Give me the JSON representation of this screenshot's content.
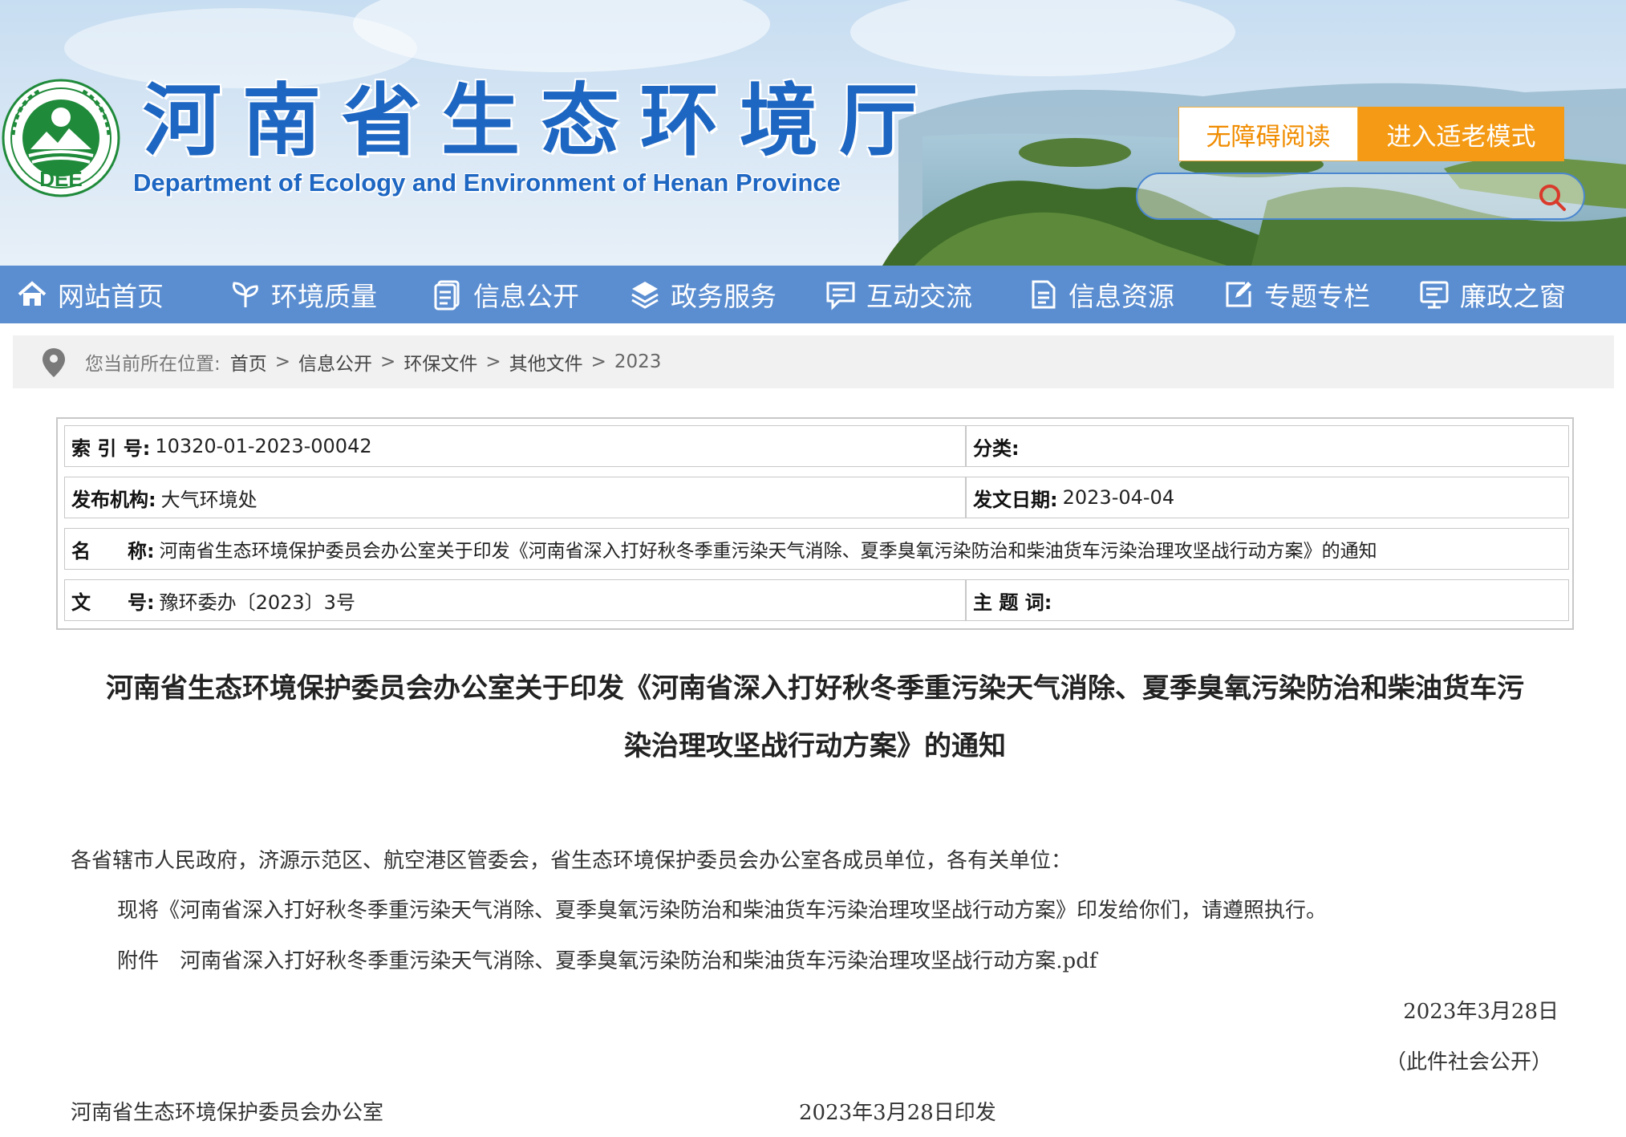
{
  "header": {
    "site_title": "河南省生态环境厅",
    "site_subtitle": "Department of Ecology and Environment of Henan Province",
    "logo_text": "DEE",
    "accessible_btn": "无障碍阅读",
    "elder_btn": "进入适老模式",
    "search_placeholder": ""
  },
  "nav": {
    "items": [
      {
        "label": "网站首页",
        "icon": "home-icon"
      },
      {
        "label": "环境质量",
        "icon": "sprout-icon"
      },
      {
        "label": "信息公开",
        "icon": "document-stack-icon"
      },
      {
        "label": "政务服务",
        "icon": "layers-icon"
      },
      {
        "label": "互动交流",
        "icon": "chat-icon"
      },
      {
        "label": "信息资源",
        "icon": "file-icon"
      },
      {
        "label": "专题专栏",
        "icon": "edit-icon"
      },
      {
        "label": "廉政之窗",
        "icon": "monitor-icon"
      }
    ]
  },
  "breadcrumb": {
    "lead": "您当前所在位置:",
    "items": [
      "首页",
      "信息公开",
      "环保文件",
      "其他文件"
    ],
    "current": "2023",
    "separator": ">"
  },
  "meta": {
    "index_label": "索 引 号:",
    "index_value": "10320-01-2023-00042",
    "category_label": "分类:",
    "category_value": "",
    "publisher_label": "发布机构:",
    "publisher_value": "大气环境处",
    "date_label": "发文日期:",
    "date_value": "2023-04-04",
    "name_label_1": "名",
    "name_label_2": "称:",
    "name_value": "河南省生态环境保护委员会办公室关于印发《河南省深入打好秋冬季重污染天气消除、夏季臭氧污染防治和柴油货车污染治理攻坚战行动方案》的通知",
    "docno_label_1": "文",
    "docno_label_2": "号:",
    "docno_value": "豫环委办〔2023〕3号",
    "subject_label": "主 题 词:",
    "subject_value": ""
  },
  "article": {
    "title_line1": "河南省生态环境保护委员会办公室关于印发《河南省深入打好秋冬季重污染天气消除、夏季臭氧污染防治和柴油货车污",
    "title_line2": "染治理攻坚战行动方案》的通知",
    "salutation": "各省辖市人民政府，济源示范区、航空港区管委会，省生态环境保护委员会办公室各成员单位，各有关单位：",
    "para1": "现将《河南省深入打好秋冬季重污染天气消除、夏季臭氧污染防治和柴油货车污染治理攻坚战行动方案》印发给你们，请遵照执行。",
    "attachment_label": "附件",
    "attachment_link": "河南省深入打好秋冬季重污染天气消除、夏季臭氧污染防治和柴油货车污染治理攻坚战行动方案.pdf",
    "sign_date": "2023年3月28日",
    "public_note": "（此件社会公开）",
    "footer_org": "河南省生态环境保护委员会办公室",
    "footer_print": "2023年3月28日印发"
  },
  "colors": {
    "title_blue": "#1d66c2",
    "nav_bg": "#5b8ed1",
    "orange": "#f49a14",
    "logo_green": "#1f8a3a"
  }
}
